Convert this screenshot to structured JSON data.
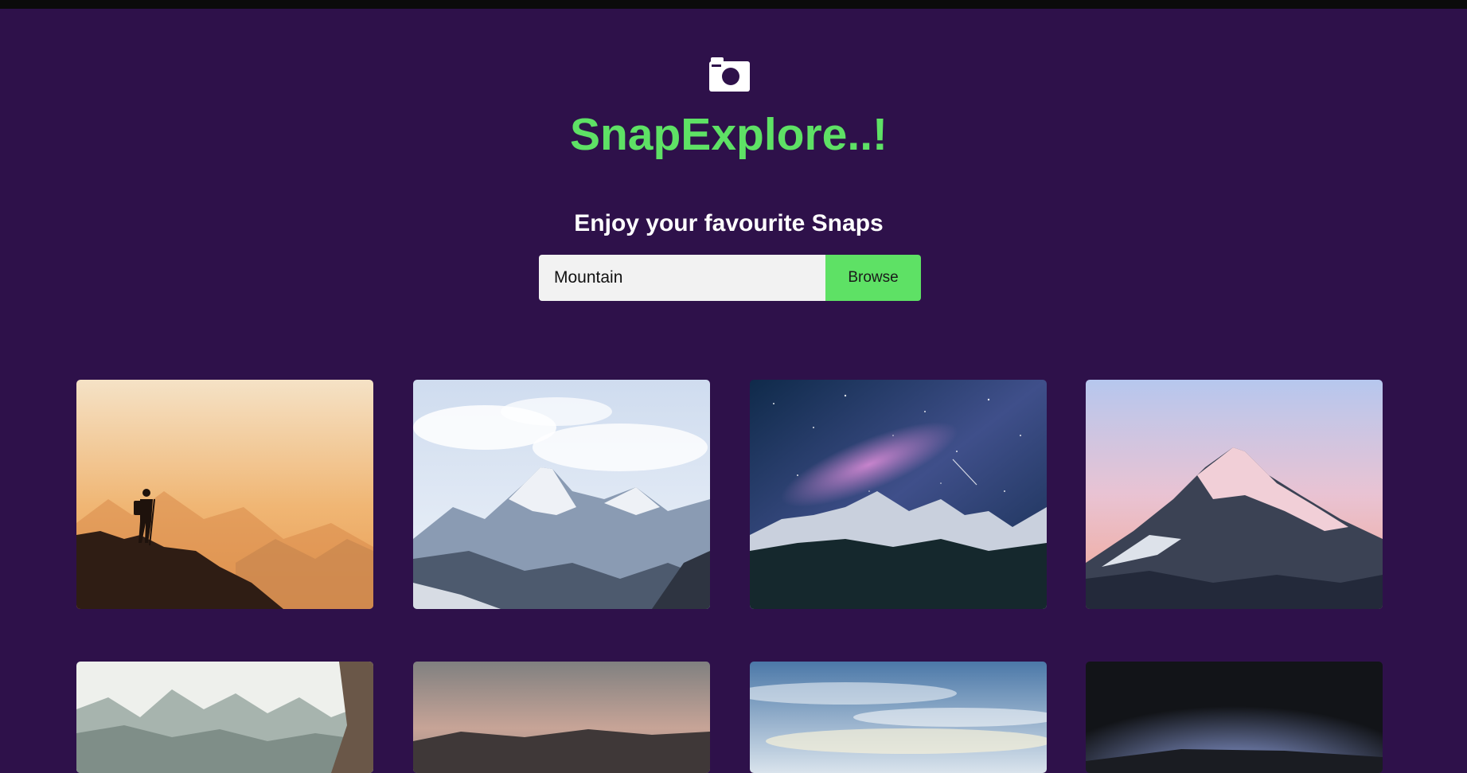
{
  "app": {
    "logo_icon": "camera-icon",
    "title": "SnapExplore..!",
    "subtitle": "Enjoy your favourite Snaps",
    "accent_color": "#5ee165",
    "background_color": "#2e114a"
  },
  "search": {
    "value": "Mountain",
    "button_label": "Browse"
  },
  "gallery": {
    "images": [
      {
        "name": "hiker-silhouette-golden-mountains"
      },
      {
        "name": "snowy-peaks-under-clouds"
      },
      {
        "name": "milky-way-over-mountains"
      },
      {
        "name": "pink-sunset-snow-peak"
      },
      {
        "name": "misty-mountain-ridges"
      },
      {
        "name": "dusk-hills-horizon"
      },
      {
        "name": "blue-sky-clouds"
      },
      {
        "name": "dark-horizon-glow"
      }
    ]
  }
}
